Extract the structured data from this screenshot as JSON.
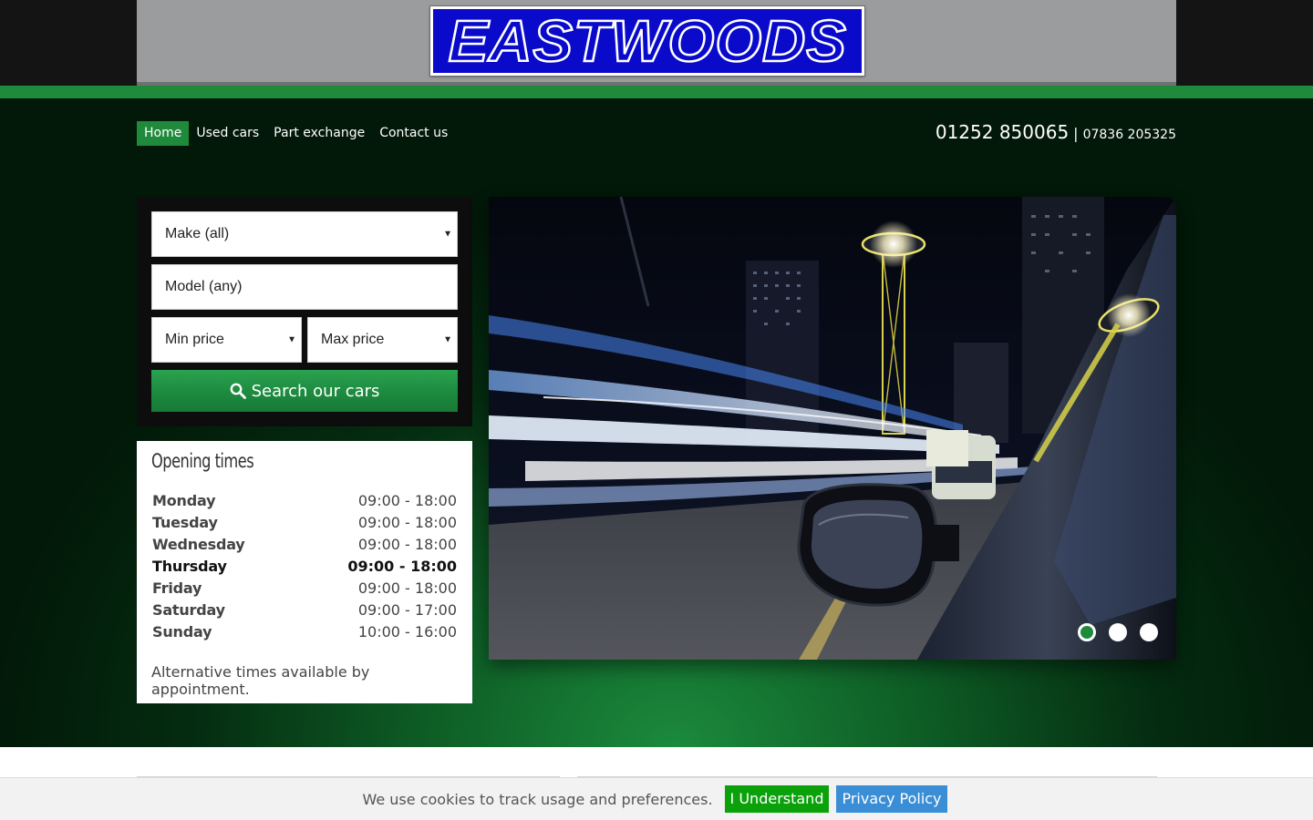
{
  "brand": {
    "name": "EASTWOODS",
    "green": "#1f8a3c",
    "logo_blue": "#0a0acb"
  },
  "nav": {
    "items": [
      {
        "label": "Home",
        "active": true
      },
      {
        "label": "Used cars",
        "active": false
      },
      {
        "label": "Part exchange",
        "active": false
      },
      {
        "label": "Contact us",
        "active": false
      }
    ]
  },
  "contact": {
    "phone_main": "01252 850065",
    "separator": "|",
    "phone_alt": "07836 205325"
  },
  "search": {
    "make_value": "Make (all)",
    "model_placeholder": "Model (any)",
    "min_price": "Min price",
    "max_price": "Max price",
    "button_label": "Search our cars",
    "button_icon": "search-icon"
  },
  "opening_times": {
    "title": "Opening times",
    "rows": [
      {
        "day": "Monday",
        "hours": "09:00 - 18:00",
        "today": false
      },
      {
        "day": "Tuesday",
        "hours": "09:00 - 18:00",
        "today": false
      },
      {
        "day": "Wednesday",
        "hours": "09:00 - 18:00",
        "today": false
      },
      {
        "day": "Thursday",
        "hours": "09:00 - 18:00",
        "today": true
      },
      {
        "day": "Friday",
        "hours": "09:00 - 18:00",
        "today": false
      },
      {
        "day": "Saturday",
        "hours": "09:00 - 17:00",
        "today": false
      },
      {
        "day": "Sunday",
        "hours": "10:00 - 16:00",
        "today": false
      }
    ],
    "note": "Alternative times available by appointment."
  },
  "slider": {
    "slide_count": 3,
    "active_index": 0
  },
  "cookie": {
    "message": "We use cookies to track usage and preferences.",
    "accept_label": "I Understand",
    "privacy_label": "Privacy Policy"
  }
}
